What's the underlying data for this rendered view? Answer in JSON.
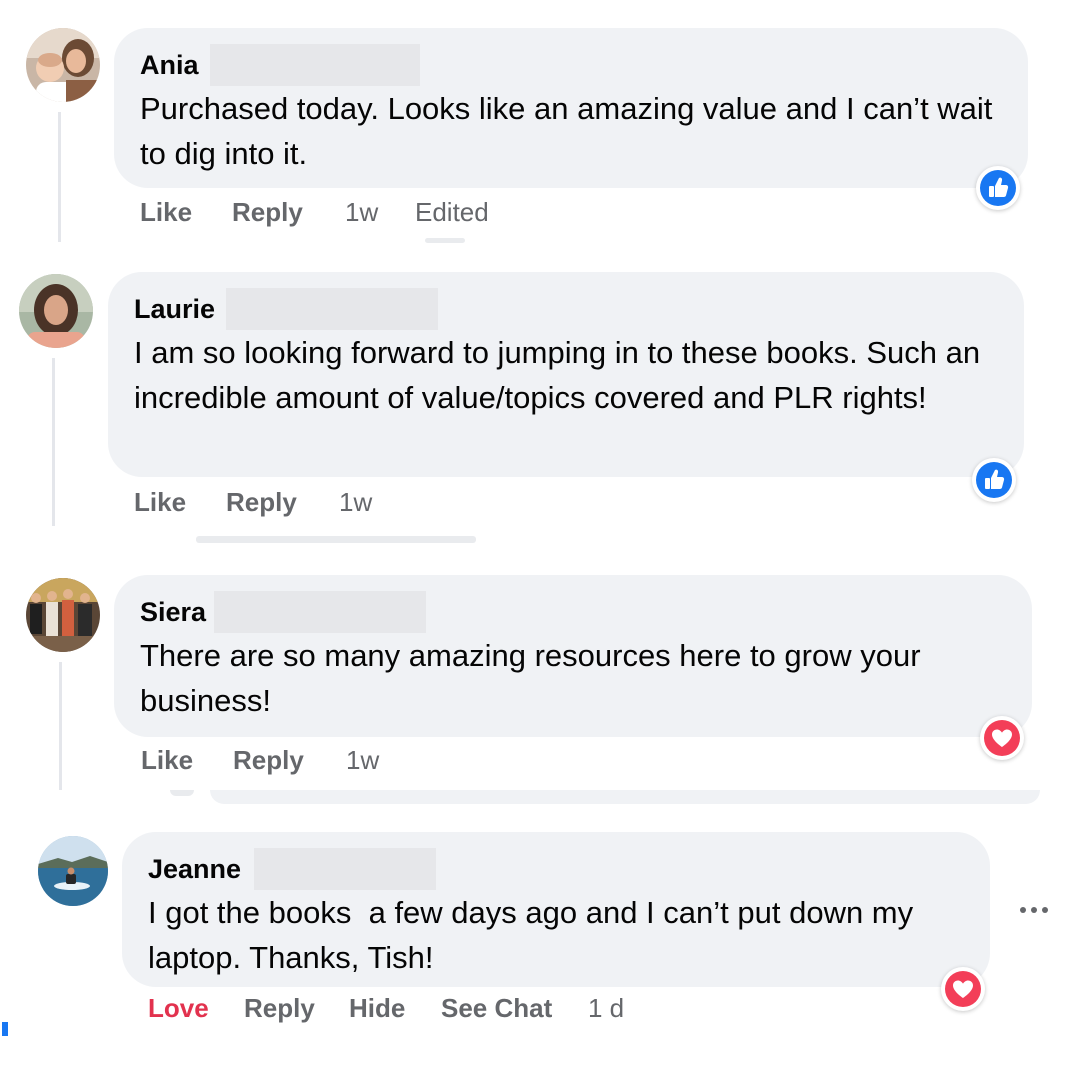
{
  "comments": [
    {
      "author": "Ania",
      "text": "Purchased today. Looks like an amazing value and I can’t wait to dig into it.",
      "actions": {
        "like": "Like",
        "reply": "Reply"
      },
      "time": "1w",
      "edited": "Edited",
      "reaction": "like",
      "avatar": "woman-with-baby"
    },
    {
      "author": "Laurie",
      "text": "I am so looking forward to jumping in to these books. Such an incredible amount of value/topics covered and PLR rights!",
      "actions": {
        "like": "Like",
        "reply": "Reply"
      },
      "time": "1w",
      "reaction": "like",
      "avatar": "woman-curly-hair"
    },
    {
      "author": "Siera",
      "text": "There are so many amazing resources here to grow your business!",
      "actions": {
        "like": "Like",
        "reply": "Reply"
      },
      "time": "1w",
      "reaction": "love",
      "avatar": "group-photo"
    },
    {
      "author": "Jeanne",
      "text": "I got the books  a few days ago and I can’t put down my laptop. Thanks, Tish!",
      "actions": {
        "love": "Love",
        "reply": "Reply",
        "hide": "Hide",
        "see_chat": "See Chat"
      },
      "time": "1 d",
      "reaction": "love",
      "avatar": "jet-ski-on-water",
      "more_icon": "more-options-icon"
    }
  ],
  "colors": {
    "bubble": "#f0f2f5",
    "action_text": "#65676b",
    "like_blue": "#1877f2",
    "love_red": "#f33e58",
    "love_label": "#e2324e"
  }
}
